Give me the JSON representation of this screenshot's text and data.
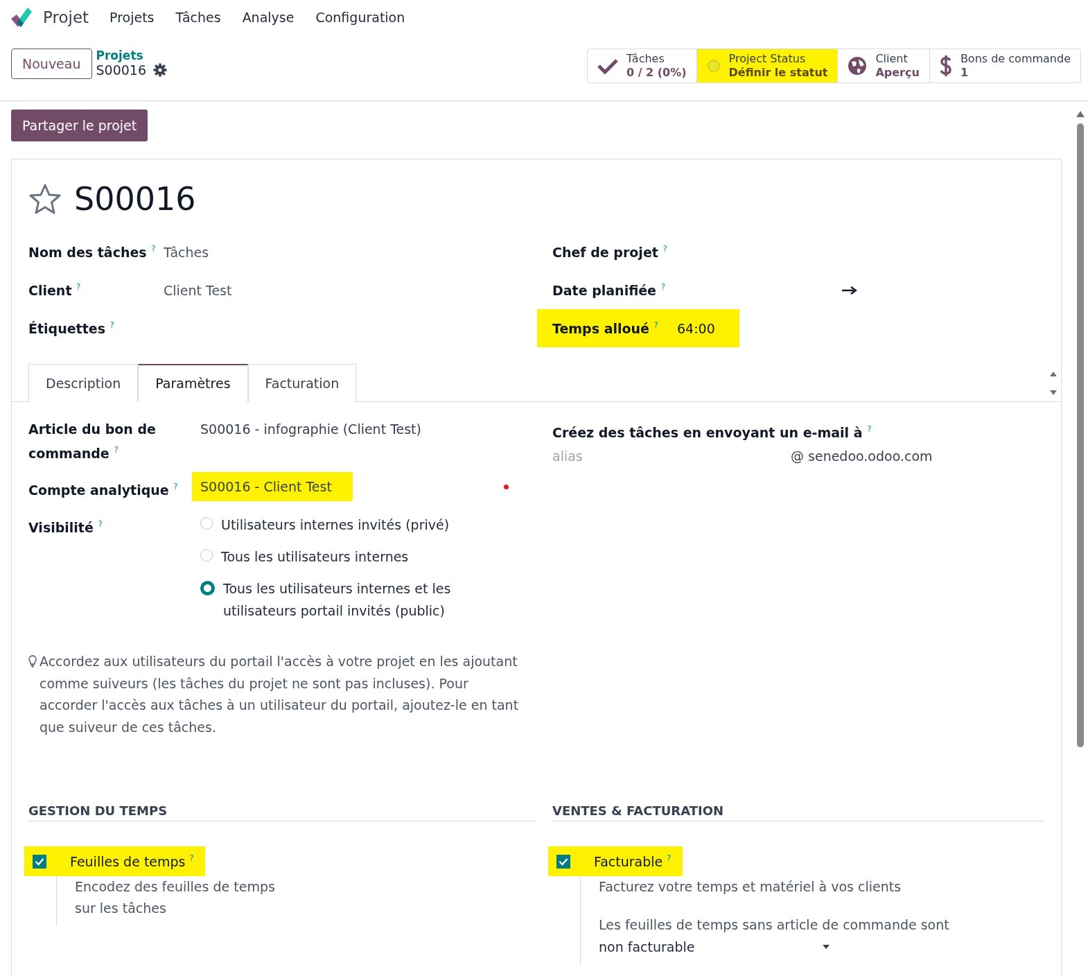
{
  "app": {
    "name": "Projet"
  },
  "menu": [
    "Projets",
    "Tâches",
    "Analyse",
    "Configuration"
  ],
  "control_panel": {
    "new_button": "Nouveau",
    "breadcrumb": "Projets",
    "record": "S00016"
  },
  "smart_buttons": [
    {
      "kind": "check",
      "title": "Tâches",
      "value": "0 / 2 (0%)",
      "highlighted": false
    },
    {
      "kind": "status",
      "title": "Project Status",
      "value": "Définir le statut",
      "highlighted": true
    },
    {
      "kind": "globe",
      "title": "Client",
      "value": "Aperçu",
      "highlighted": false
    },
    {
      "kind": "dollar",
      "title": "Bons de commande",
      "value": "1",
      "highlighted": false
    }
  ],
  "share_button": "Partager le projet",
  "record": {
    "title": "S00016",
    "favorite": false
  },
  "left_fields": [
    {
      "label": "Nom des tâches",
      "help": "?",
      "value": "Tâches"
    },
    {
      "label": "Client",
      "help": "?",
      "value": "Client Test"
    },
    {
      "label": "Étiquettes",
      "help": "?"
    }
  ],
  "right_fields": [
    {
      "kind": "text",
      "label": "Chef de projet",
      "help": "?",
      "highlighted": false
    },
    {
      "kind": "daterange",
      "label": "Date planifiée",
      "help": "?",
      "highlighted": false
    },
    {
      "kind": "text",
      "label": "Temps alloué",
      "help": "?",
      "value": "64:00",
      "highlighted": true
    }
  ],
  "tabs": [
    {
      "label": "Description",
      "selected": false
    },
    {
      "label": "Paramètres",
      "selected": true
    },
    {
      "label": "Facturation",
      "selected": false
    }
  ],
  "settings": {
    "fields": [
      {
        "label": "Article du bon de commande",
        "help": "?",
        "value": "S00016 - infographie (Client Test)",
        "highlighted": false
      },
      {
        "label": "Compte analytique",
        "help": "?",
        "value": "S00016 - Client Test",
        "highlighted": true
      }
    ],
    "visibility": {
      "label": "Visibilité",
      "help": "?",
      "options": [
        {
          "label": "Utilisateurs internes invités (privé)",
          "selected": false
        },
        {
          "label": "Tous les utilisateurs internes",
          "selected": false
        },
        {
          "label": "Tous les utilisateurs internes et les utilisateurs portail invités (public)",
          "selected": true
        }
      ]
    },
    "hint": "Accordez aux utilisateurs du portail l'accès à votre projet en les ajoutant comme suiveurs (les tâches du projet ne sont pas incluses). Pour accorder l'accès aux tâches à un utilisateur du portail, ajoutez-le en tant que suiveur de ces tâches.",
    "email": {
      "label": "Créez des tâches en envoyant un e-mail à",
      "help": "?",
      "placeholder": "alias",
      "domain": "@ senedoo.odoo.com"
    }
  },
  "sections": [
    {
      "title": "GESTION DU TEMPS",
      "options": [
        {
          "label": "Feuilles de temps",
          "help": "?",
          "checked": true,
          "highlighted": true,
          "description": "Encodez des feuilles de temps sur les tâches"
        }
      ]
    },
    {
      "title": "VENTES & FACTURATION",
      "options": [
        {
          "label": "Facturable",
          "help": "?",
          "checked": true,
          "highlighted": true,
          "description": "Facturez votre temps et matériel à vos clients",
          "select": {
            "label": "Les feuilles de temps sans article de commande sont",
            "value": "non facturable"
          }
        }
      ]
    }
  ]
}
